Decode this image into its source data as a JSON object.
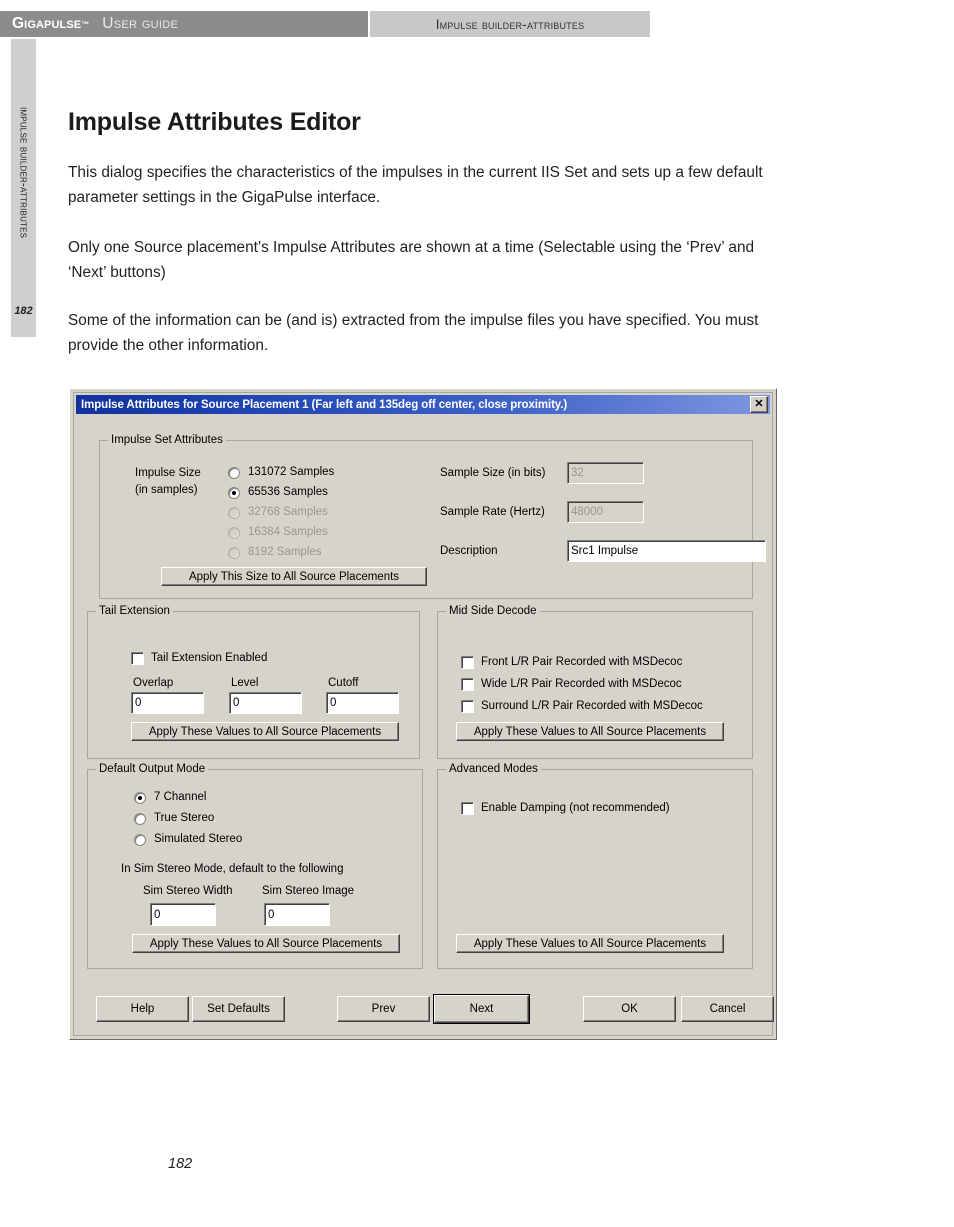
{
  "header": {
    "brand": "GigaPulse",
    "trademark": "™",
    "guide_label": "User Guide",
    "section_label": "Impulse Builder-Attributes"
  },
  "side_tab": {
    "label": "Impulse Builder-Attributes",
    "page_number": "182"
  },
  "doc": {
    "title": "Impulse Attributes Editor",
    "paragraph1": "This dialog specifies the characteristics of the impulses in the current IIS Set and sets up a few default parameter settings in the GigaPulse interface.",
    "paragraph2": "Only one Source placement’s Impulse Attributes are shown at a time (Selectable using the ‘Prev’ and ‘Next’ buttons)",
    "paragraph3": "Some of the information can be (and is) extracted from the impulse files you have specified. You must provide the other information."
  },
  "dialog": {
    "title": "Impulse Attributes for Source Placement 1 (Far left and 135deg off center, close proximity.)",
    "close_label": "✕",
    "impulse_set": {
      "group_title": "Impulse Set Attributes",
      "impulse_size_label_line1": "Impulse Size",
      "impulse_size_label_line2": "(in samples)",
      "radios": [
        {
          "label": "131072 Samples",
          "checked": false,
          "disabled": false
        },
        {
          "label": "65536 Samples",
          "checked": true,
          "disabled": false
        },
        {
          "label": "32768 Samples",
          "checked": false,
          "disabled": true
        },
        {
          "label": "16384 Samples",
          "checked": false,
          "disabled": true
        },
        {
          "label": "8192 Samples",
          "checked": false,
          "disabled": true
        }
      ],
      "apply_button": "Apply This Size to All Source Placements",
      "sample_size_label": "Sample Size (in bits)",
      "sample_size_value": "32",
      "sample_rate_label": "Sample Rate (Hertz)",
      "sample_rate_value": "48000",
      "description_label": "Description",
      "description_value": "Src1 Impulse"
    },
    "tail_extension": {
      "group_title": "Tail Extension",
      "enabled_label": "Tail Extension Enabled",
      "enabled_checked": false,
      "overlap_label": "Overlap",
      "overlap_value": "0",
      "level_label": "Level",
      "level_value": "0",
      "cutoff_label": "Cutoff",
      "cutoff_value": "0",
      "apply_button": "Apply These Values to All Source Placements"
    },
    "mid_side_decode": {
      "group_title": "Mid Side Decode",
      "checkboxes": [
        {
          "label": "Front L/R Pair Recorded with MSDecoc",
          "checked": false
        },
        {
          "label": "Wide L/R Pair Recorded with MSDecoc",
          "checked": false
        },
        {
          "label": "Surround L/R Pair Recorded with MSDecoc",
          "checked": false
        }
      ],
      "apply_button": "Apply These Values to All Source Placements"
    },
    "default_output_mode": {
      "group_title": "Default Output Mode",
      "radios": [
        {
          "label": "7 Channel",
          "checked": true
        },
        {
          "label": "True Stereo",
          "checked": false
        },
        {
          "label": "Simulated Stereo",
          "checked": false
        }
      ],
      "sim_note": "In Sim Stereo Mode, default to the following",
      "sim_width_label": "Sim Stereo Width",
      "sim_width_value": "0",
      "sim_image_label": "Sim Stereo Image",
      "sim_image_value": "0",
      "apply_button": "Apply These Values to All Source Placements"
    },
    "advanced_modes": {
      "group_title": "Advanced Modes",
      "damping_label": "Enable Damping (not recommended)",
      "damping_checked": false,
      "apply_button": "Apply These Values to All Source Placements"
    },
    "buttons": {
      "help": "Help",
      "set_defaults": "Set Defaults",
      "prev": "Prev",
      "next": "Next",
      "ok": "OK",
      "cancel": "Cancel"
    }
  },
  "footer": {
    "page_number": "182"
  },
  "colors": {
    "header_band_left": "#8c8c8c",
    "header_band_right": "#c8c8c8",
    "side_tab": "#cfcfcf",
    "dialog_face": "#d6d3ca",
    "titlebar_start": "#12329c",
    "titlebar_end": "#7e97e0"
  }
}
